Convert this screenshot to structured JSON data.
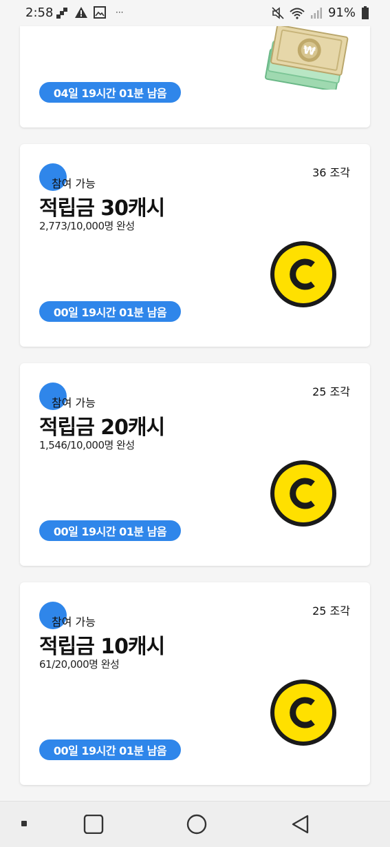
{
  "status_bar": {
    "time": "2:58",
    "battery": "91%",
    "icons": [
      "stack-icon",
      "warning-icon",
      "image-icon",
      "more-icon",
      "mute-icon",
      "wifi-icon",
      "signal-icon",
      "battery-icon"
    ]
  },
  "cards": [
    {
      "timer": "04일 19시간 01분 남음",
      "image": "money-bills-icon"
    },
    {
      "status": "참여 가능",
      "pieces": "36 조각",
      "title": "적립금 30캐시",
      "progress": "2,773/10,000명 완성",
      "timer": "00일 19시간 01분 남음",
      "image": "coin-c-icon"
    },
    {
      "status": "참여 가능",
      "pieces": "25 조각",
      "title": "적립금 20캐시",
      "progress": "1,546/10,000명 완성",
      "timer": "00일 19시간 01분 남음",
      "image": "coin-c-icon"
    },
    {
      "status": "참여 가능",
      "pieces": "25 조각",
      "title": "적립금 10캐시",
      "progress": "61/20,000명 완성",
      "timer": "00일 19시간 01분 남음",
      "image": "coin-c-icon"
    }
  ],
  "colors": {
    "accent": "#2f86ea",
    "coin_yellow": "#ffe000",
    "coin_outline": "#1a1a1a"
  },
  "nav": [
    "recents-button",
    "home-button",
    "back-button"
  ]
}
